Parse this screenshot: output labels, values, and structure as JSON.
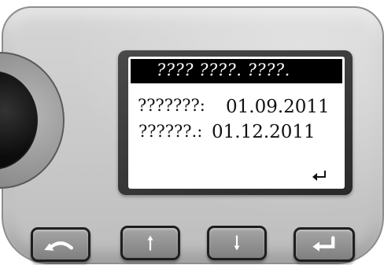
{
  "display": {
    "title": "???? ????. ????.",
    "rows": [
      {
        "label": "???????:",
        "value": "01.09.2011"
      },
      {
        "label": "??????.:",
        "value": "01.12.2011"
      }
    ],
    "enter_indicator_icon": "enter-return-icon"
  },
  "buttons": [
    {
      "name": "back-button",
      "icon": "back-arc-icon"
    },
    {
      "name": "up-button",
      "icon": "arrow-up-icon"
    },
    {
      "name": "down-button",
      "icon": "arrow-down-icon"
    },
    {
      "name": "enter-button",
      "icon": "enter-return-icon"
    }
  ],
  "colors": {
    "body": "#c9c9c9",
    "screen": "#ffffff",
    "title_bar": "#000000",
    "button": "#8f8f8f",
    "button_border": "#1e1e1e",
    "knob": "#000000"
  }
}
